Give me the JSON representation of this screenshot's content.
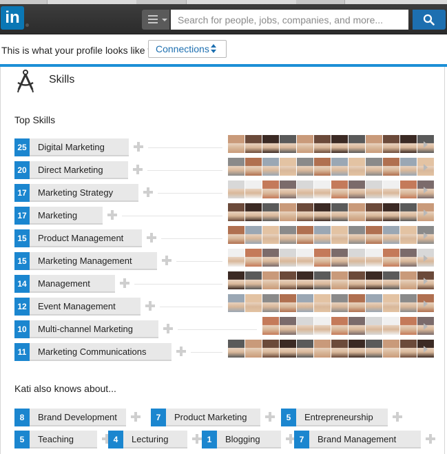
{
  "header": {
    "search_placeholder": "Search for people, jobs, companies, and more..."
  },
  "profile_view": {
    "text": "This is what your profile looks like to",
    "selected": "Connections"
  },
  "skills": {
    "title": "Skills",
    "top_label": "Top Skills",
    "top": [
      {
        "count": "25",
        "name": "Digital Marketing"
      },
      {
        "count": "20",
        "name": "Direct Marketing"
      },
      {
        "count": "17",
        "name": "Marketing Strategy"
      },
      {
        "count": "17",
        "name": "Marketing"
      },
      {
        "count": "15",
        "name": "Product Management"
      },
      {
        "count": "15",
        "name": "Marketing Management"
      },
      {
        "count": "14",
        "name": "Management"
      },
      {
        "count": "12",
        "name": "Event Management"
      },
      {
        "count": "10",
        "name": "Multi-channel Marketing"
      },
      {
        "count": "11",
        "name": "Marketing Communications"
      }
    ],
    "also_label": "Kati also knows about...",
    "also": [
      {
        "count": "8",
        "name": "Brand Development"
      },
      {
        "count": "7",
        "name": "Product Marketing"
      },
      {
        "count": "5",
        "name": "Entrepreneurship"
      },
      {
        "count": "5",
        "name": "Teaching"
      },
      {
        "count": "4",
        "name": "Lecturing"
      },
      {
        "count": "1",
        "name": "Blogging"
      },
      {
        "count": "7",
        "name": "Brand Management"
      }
    ]
  },
  "colors": {
    "accent": "#1b86cf",
    "topbar": "#2f2f2f",
    "search_button": "#1d6fb0"
  }
}
